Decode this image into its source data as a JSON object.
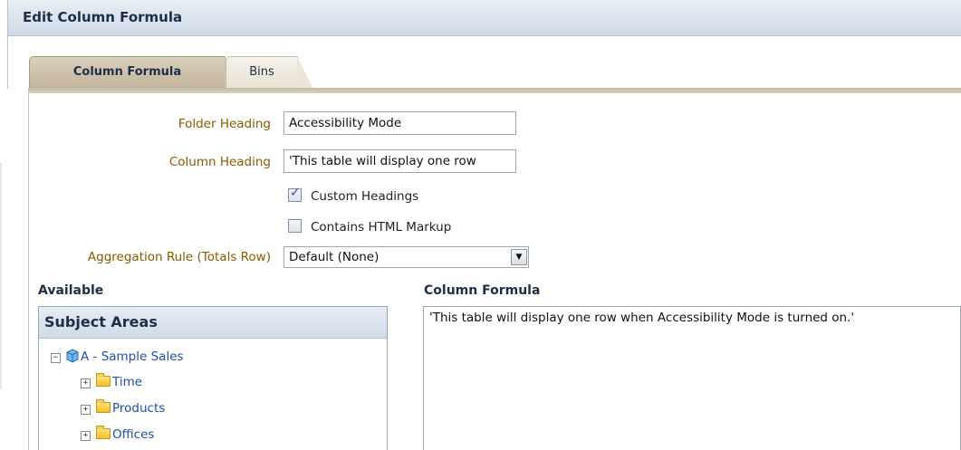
{
  "dialog": {
    "title": "Edit Column Formula"
  },
  "tabs": [
    {
      "label": "Column Formula",
      "active": true
    },
    {
      "label": "Bins",
      "active": false
    }
  ],
  "form": {
    "folder_heading_label": "Folder Heading",
    "folder_heading_value": "Accessibility Mode",
    "column_heading_label": "Column Heading",
    "column_heading_value": "'This table will display one row",
    "custom_headings_label": "Custom Headings",
    "custom_headings_checked": true,
    "contains_html_label": "Contains HTML Markup",
    "contains_html_checked": false,
    "aggregation_label": "Aggregation Rule (Totals Row)",
    "aggregation_value": "Default (None)"
  },
  "available": {
    "heading": "Available",
    "panel_title": "Subject Areas",
    "tree": [
      {
        "label": "A - Sample Sales",
        "icon": "cube-icon",
        "expander": "minus"
      },
      {
        "label": "Time",
        "icon": "folder-icon",
        "expander": "plus"
      },
      {
        "label": "Products",
        "icon": "folder-icon",
        "expander": "plus"
      },
      {
        "label": "Offices",
        "icon": "folder-icon",
        "expander": "plus"
      }
    ]
  },
  "formula": {
    "heading": "Column Formula",
    "text": "'This table will display one row when Accessibility Mode is turned on.'"
  },
  "colors": {
    "label_text": "#8a5a00",
    "tree_link": "#1f4ea8",
    "tab_active": "#c2b49b",
    "header_blue": "#cfd9e6"
  }
}
